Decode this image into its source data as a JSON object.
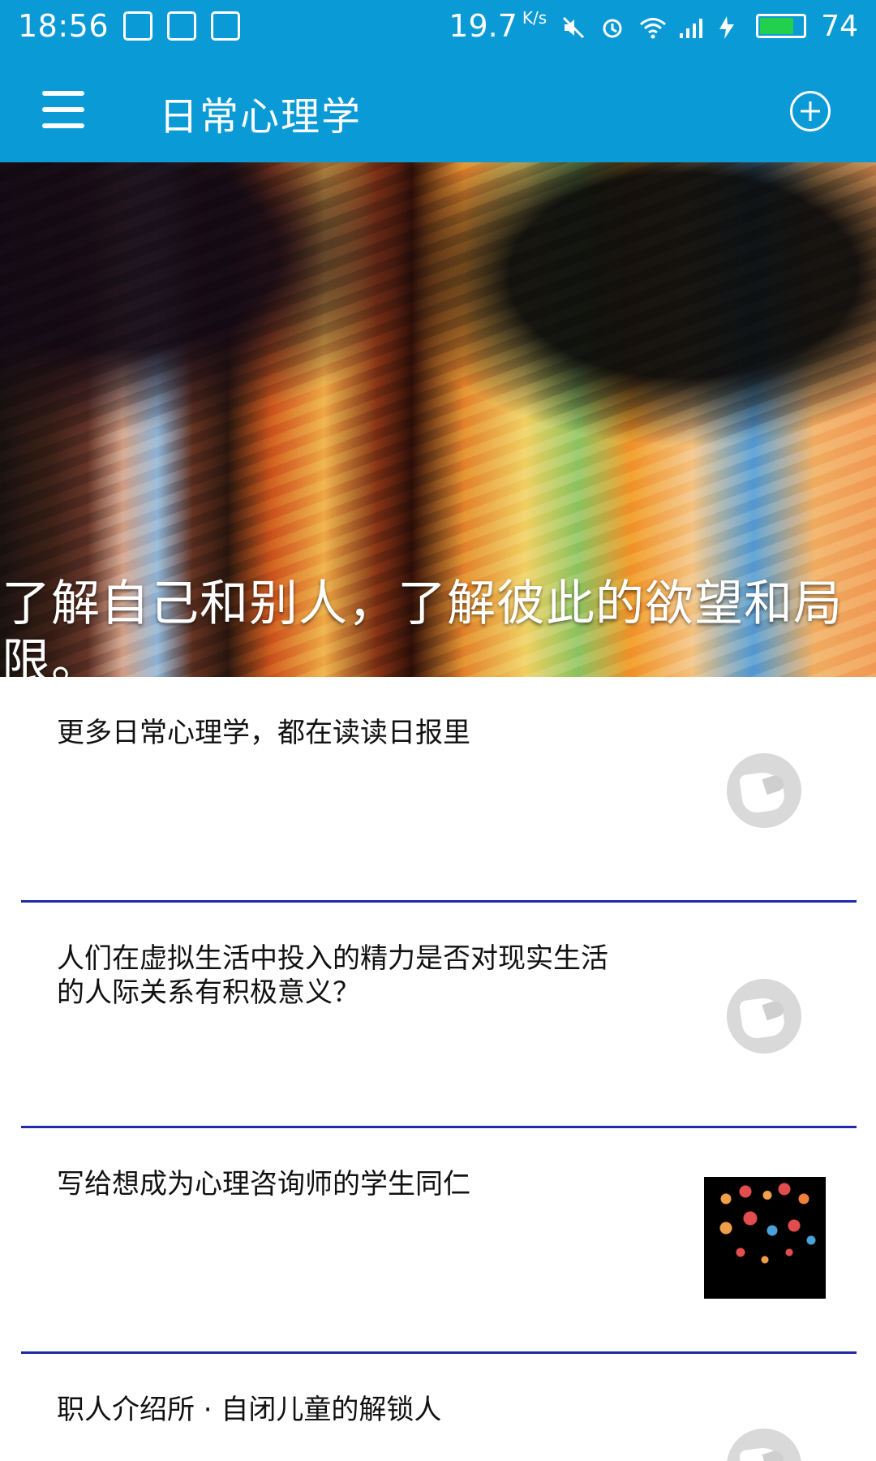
{
  "status_bar": {
    "time": "18:56",
    "network_speed": "19.7",
    "network_speed_unit": "K/s",
    "battery_level": "74"
  },
  "app_bar": {
    "title": "日常心理学"
  },
  "hero": {
    "caption": "了解自己和别人，了解彼此的欲望和局限。"
  },
  "feed": {
    "items": [
      {
        "title": "更多日常心理学，都在读读日报里"
      },
      {
        "title": "人们在虚拟生活中投入的精力是否对现实生活的人际关系有积极意义？"
      },
      {
        "title": "写给想成为心理咨询师的学生同仁"
      },
      {
        "title": "职人介绍所 · 自闭儿童的解锁人"
      }
    ]
  },
  "colors": {
    "primary": "#0a9ad6",
    "divider": "#1f2aa3",
    "battery_fill": "#22d04d"
  },
  "icons": {
    "menu": "menu-icon",
    "add": "add-circle-icon"
  }
}
